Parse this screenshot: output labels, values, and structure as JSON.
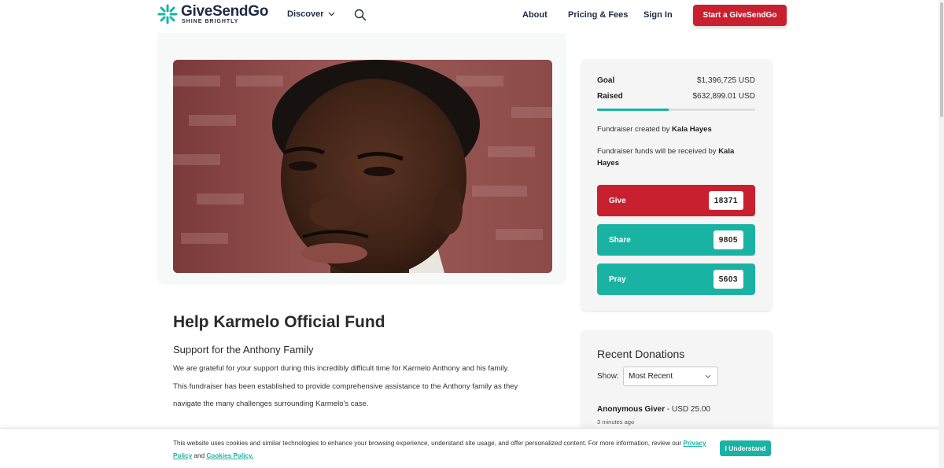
{
  "header": {
    "logo_name": "GiveSendGo",
    "logo_tagline": "SHINE BRIGHTLY",
    "discover_label": "Discover",
    "about_label": "About",
    "pricing_label": "Pricing & Fees",
    "signin_label": "Sign In",
    "start_label": "Start a GiveSendGo"
  },
  "campaign": {
    "title": "Help Karmelo Official Fund",
    "subtitle": "Support for the Anthony Family",
    "paragraph_1": "We are grateful for your support during this incredibly difficult time for Karmelo Anthony and his family.",
    "paragraph_2": "This fundraiser has been established to provide comprehensive assistance to the Anthony family as they",
    "paragraph_3": "navigate the many challenges surrounding Karmelo's case."
  },
  "stats": {
    "goal_label": "Goal",
    "goal_value": "$1,396,725 USD",
    "raised_label": "Raised",
    "raised_value": "$632,899.01 USD",
    "progress_fraction": 0.453,
    "created_by_text": "Fundraiser created by ",
    "created_by_name": "Kala Hayes",
    "received_by_text": "Fundraiser funds will be received by ",
    "received_by_name": "Kala Hayes"
  },
  "actions": {
    "give_label": "Give",
    "give_count": "18371",
    "share_label": "Share",
    "share_count": "9805",
    "pray_label": "Pray",
    "pray_count": "5603"
  },
  "donations": {
    "title": "Recent Donations",
    "show_label": "Show:",
    "show_selected": "Most Recent",
    "first_donor_name": "Anonymous Giver",
    "first_donor_amount": " - USD 25.00",
    "first_donor_time": "3 minutes ago"
  },
  "cookie": {
    "text": "This website uses cookies and similar technologies to enhance your browsing experience, understand site usage, and offer personalized content. For more information, review our ",
    "privacy_link": "Privacy Policy",
    "and_text": " and ",
    "cookies_link": "Cookies Policy.",
    "accept_label": "I Understand"
  },
  "colors": {
    "brand_red": "#c8202f",
    "brand_teal": "#1ab3a3",
    "navy": "#1e2a44"
  }
}
